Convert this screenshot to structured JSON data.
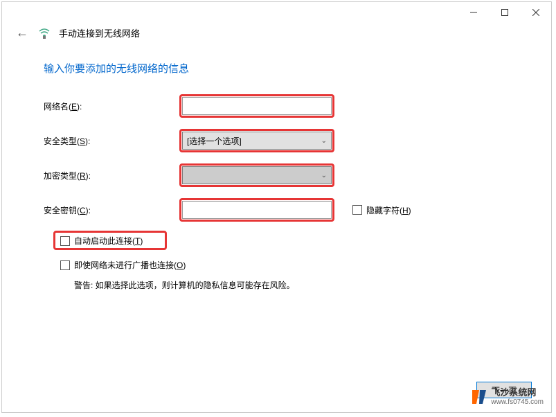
{
  "window": {
    "title": "手动连接到无线网络"
  },
  "heading": "输入你要添加的无线网络的信息",
  "form": {
    "network_name": {
      "label_prefix": "网络名(",
      "hotkey": "E",
      "label_suffix": "):",
      "value": ""
    },
    "security_type": {
      "label_prefix": "安全类型(",
      "hotkey": "S",
      "label_suffix": "):",
      "selected": "[选择一个选项]"
    },
    "encryption_type": {
      "label_prefix": "加密类型(",
      "hotkey": "R",
      "label_suffix": "):",
      "selected": ""
    },
    "security_key": {
      "label_prefix": "安全密钥(",
      "hotkey": "C",
      "label_suffix": "):",
      "value": ""
    },
    "hide_chars": {
      "label_prefix": "隐藏字符(",
      "hotkey": "H",
      "label_suffix": ")"
    },
    "auto_start": {
      "label_prefix": "自动启动此连接(",
      "hotkey": "T",
      "label_suffix": ")"
    },
    "connect_hidden": {
      "label_prefix": "即使网络未进行广播也连接(",
      "hotkey": "O",
      "label_suffix": ")"
    },
    "warning": "警告: 如果选择此选项，则计算机的隐私信息可能存在风险。"
  },
  "footer": {
    "next": "下一页"
  },
  "watermark": {
    "title": "飞沙系统网",
    "url": "www.fs0745.com"
  }
}
